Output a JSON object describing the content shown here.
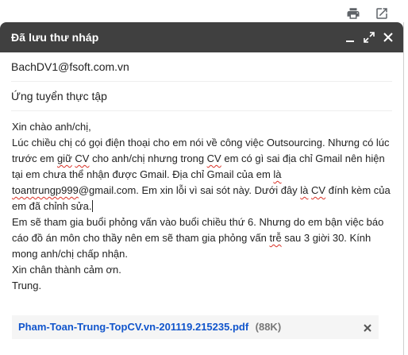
{
  "top_actions": {
    "print_icon": "printer-icon",
    "popout_icon": "open-in-new-icon"
  },
  "compose": {
    "title": "Đã lưu thư nháp",
    "header_icons": [
      "minimize-icon",
      "fullscreen-icon",
      "close-icon"
    ],
    "to": "BachDV1@fsoft.com.vn",
    "subject": "Ứng tuyển thực tập",
    "body": {
      "greeting": "Xin chào anh/chị,",
      "p1": [
        {
          "t": "Lúc chiều chị có gọi điện thoại cho em nói về công việc Outsourcing. Nhưng có lúc trước em "
        },
        {
          "t": "giữ",
          "sq": true
        },
        {
          "t": " "
        },
        {
          "t": "CV",
          "sq": true
        },
        {
          "t": " cho anh/chị nhưng trong "
        },
        {
          "t": "CV",
          "sq": true
        },
        {
          "t": " em có gì sai  địa chỉ Gmail nên hiện tại em chưa thể nhận được Gmail. Địa chỉ Gmail của em "
        },
        {
          "t": "là",
          "sq": true
        },
        {
          "t": " "
        },
        {
          "t": "toantrungp999",
          "sq": true
        },
        {
          "t": "@gmail.com. Em xin lỗi vì sai sót này. Dưới đây "
        },
        {
          "t": "là",
          "sq": true
        },
        {
          "t": " "
        },
        {
          "t": "CV",
          "sq": true
        },
        {
          "t": " đính kèm của em đã chỉnh sửa."
        }
      ],
      "p2": [
        {
          "t": "Em sẽ tham gia buổi phỏng vấn vào buổi chiều thứ 6. Nhưng do em bận việc báo cáo đồ án môn cho thầy nên em sẽ tham gia phỏng vấn "
        },
        {
          "t": "trễ",
          "sq": true
        },
        {
          "t": " sau 3 giời 30. Kính mong anh/chị chấp nhận."
        }
      ],
      "closing": "Xin chân thành cảm ơn.",
      "signature": "Trung."
    },
    "attachment": {
      "name": "Pham-Toan-Trung-TopCV.vn-201119.215235.pdf",
      "size": "(88K)"
    }
  },
  "colors": {
    "header_bg": "#404040",
    "link": "#1155cc",
    "spell_error": "#d93025"
  }
}
